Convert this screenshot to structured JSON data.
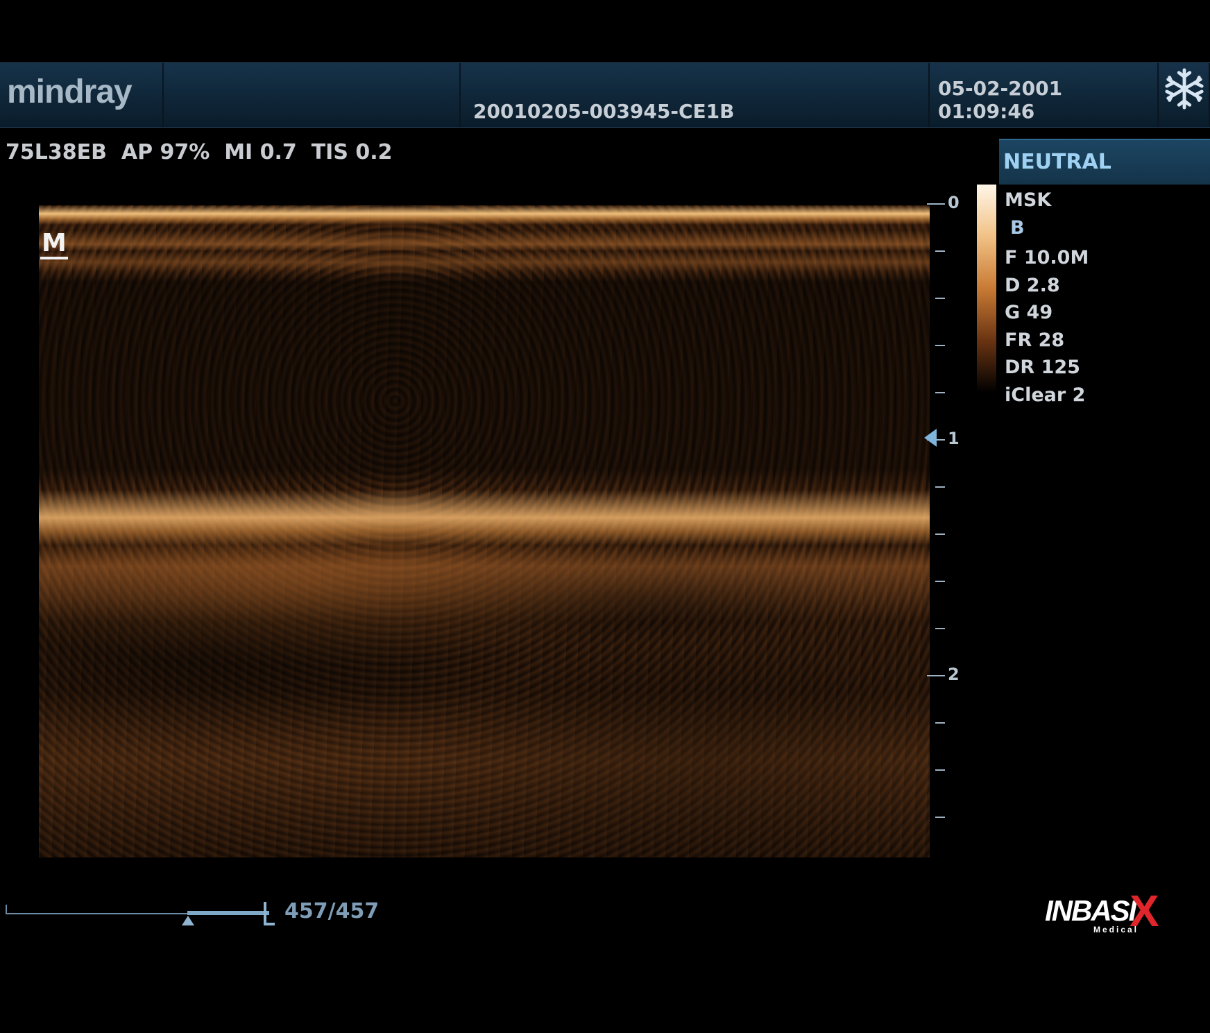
{
  "header": {
    "logo": "mindray",
    "exam_id": "20010205-003945-CE1B",
    "datetime": "05-02-2001 01:09:46",
    "freeze_icon": "snowflake-icon"
  },
  "probe_info": "75L38EB  AP 97%  MI 0.7  TIS 0.2",
  "image": {
    "orientation_marker": "M"
  },
  "depth_scale": {
    "labels": [
      "0",
      "1",
      "2"
    ],
    "unit_ticks_between": 4,
    "focus_depth": 1.0
  },
  "preset": "NEUTRAL",
  "params": {
    "application": "MSK",
    "mode": "B",
    "items": [
      "F 10.0M",
      "D 2.8",
      "G 49",
      "FR 28",
      "DR 125",
      "iClear 2"
    ]
  },
  "cine": {
    "frame_counter": "457/457",
    "current_frame": 457,
    "total_frames": 457
  },
  "watermark": {
    "text": "INBASI",
    "mark": "X",
    "sub": "Medical"
  },
  "colors": {
    "header_bg": "#0f2638",
    "preset_bg": "#1c4562",
    "accent_blue": "#7fb4dd",
    "watermark_red": "#e0262b"
  }
}
